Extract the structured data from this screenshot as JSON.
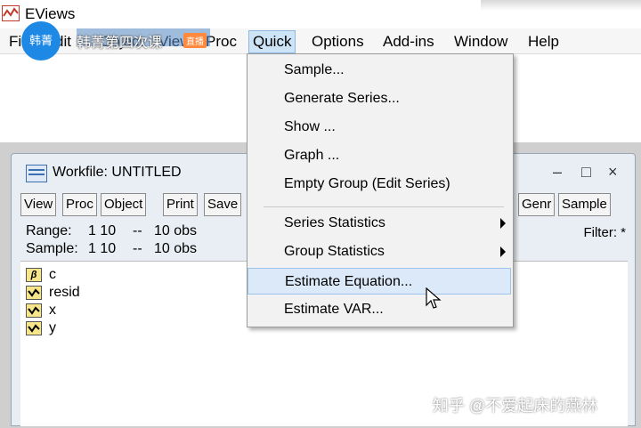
{
  "app": {
    "title": "EViews"
  },
  "menubar": {
    "items": [
      "File",
      "Edit",
      "Object",
      "View",
      "Proc",
      "Quick",
      "Options",
      "Add-ins",
      "Window",
      "Help"
    ],
    "visible_partial": {
      "file": "Fi",
      "edit": "dit",
      "object": "Object",
      "view": "View",
      "proc": "Proc",
      "quick": "Quick",
      "options": "Options",
      "addins": "Add-ins",
      "window": "Window",
      "help": "Help"
    }
  },
  "overlay": {
    "avatar_text": "韩菁",
    "stream_text": "韩菁第四次课",
    "live_tag": "直播"
  },
  "quick_menu": {
    "items": [
      {
        "label": "Sample...",
        "submenu": false
      },
      {
        "label": "Generate Series...",
        "submenu": false
      },
      {
        "label": "Show ...",
        "submenu": false
      },
      {
        "label": "Graph ...",
        "submenu": false
      },
      {
        "label": "Empty Group (Edit Series)",
        "submenu": false
      },
      {
        "label": "Series Statistics",
        "submenu": true
      },
      {
        "label": "Group Statistics",
        "submenu": true
      },
      {
        "label": "Estimate Equation...",
        "submenu": false,
        "highlighted": true
      },
      {
        "label": "Estimate VAR...",
        "submenu": false
      }
    ]
  },
  "workfile": {
    "title": "Workfile: UNTITLED",
    "toolbar": [
      "View",
      "Proc",
      "Object",
      "Print",
      "Save",
      "Genr",
      "Sample"
    ],
    "range_label": "Range:",
    "range_value": "1 10",
    "range_obs": "--   10 obs",
    "sample_label": "Sample:",
    "sample_value": "1 10",
    "sample_obs": "--   10 obs",
    "filter": "Filter: *",
    "objects": [
      {
        "name": "c",
        "icon": "coefficient-icon"
      },
      {
        "name": "resid",
        "icon": "series-icon"
      },
      {
        "name": "x",
        "icon": "series-icon"
      },
      {
        "name": "y",
        "icon": "series-icon"
      }
    ],
    "controls": {
      "minimize": "–",
      "maximize": "□",
      "close": "×"
    }
  },
  "watermark": "知乎 @不爱起床的燕林",
  "colors": {
    "menu_highlight": "#cde3f6",
    "dropdown_hover": "#dce9f8",
    "object_icon": "#f6e58b",
    "accent_blue": "#1e88e5"
  }
}
